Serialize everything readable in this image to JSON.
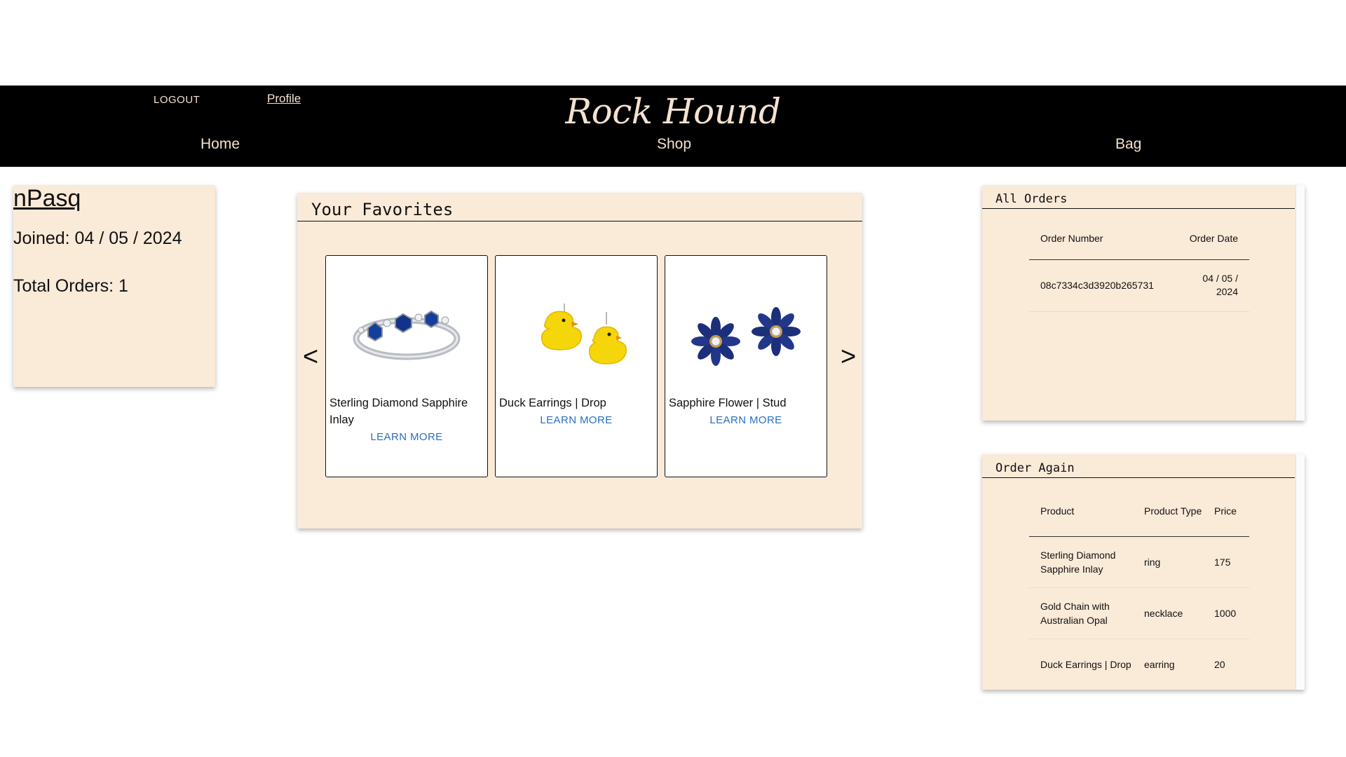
{
  "header": {
    "logout_label": "LOGOUT",
    "profile_label": "Profile",
    "brand": "Rock Hound",
    "nav": {
      "home": "Home",
      "shop": "Shop",
      "bag": "Bag"
    }
  },
  "user": {
    "username": "nPasq",
    "joined": "Joined: 04 / 05 / 2024",
    "total_orders": "Total Orders: 1"
  },
  "favorites": {
    "title": "Your Favorites",
    "prev": "<",
    "next": ">",
    "items": [
      {
        "name": "Sterling Diamond Sapphire Inlay",
        "learn_more": "LEARN MORE",
        "image_icon": "sapphire-ring-icon"
      },
      {
        "name": "Duck Earrings | Drop",
        "learn_more": "LEARN MORE",
        "image_icon": "duck-earrings-icon"
      },
      {
        "name": "Sapphire Flower | Stud",
        "learn_more": "LEARN MORE",
        "image_icon": "flower-stud-icon"
      }
    ]
  },
  "all_orders": {
    "title": "All Orders",
    "columns": [
      "Order Number",
      "Order Date"
    ],
    "rows": [
      {
        "order_number": "08c7334c3d3920b265731",
        "order_date": "04 / 05 / 2024"
      }
    ]
  },
  "order_again": {
    "title": "Order Again",
    "columns": [
      "Product",
      "Product Type",
      "Price"
    ],
    "rows": [
      {
        "product": "Sterling Diamond Sapphire Inlay",
        "type": "ring",
        "price": "175"
      },
      {
        "product": "Gold Chain with Australian Opal",
        "type": "necklace",
        "price": "1000"
      },
      {
        "product": "Duck Earrings | Drop",
        "type": "earring",
        "price": "20"
      }
    ]
  },
  "colors": {
    "header_bg": "#000000",
    "header_text": "#f4e2d0",
    "card_bg": "#faead8",
    "link_blue": "#2a6fc0"
  }
}
